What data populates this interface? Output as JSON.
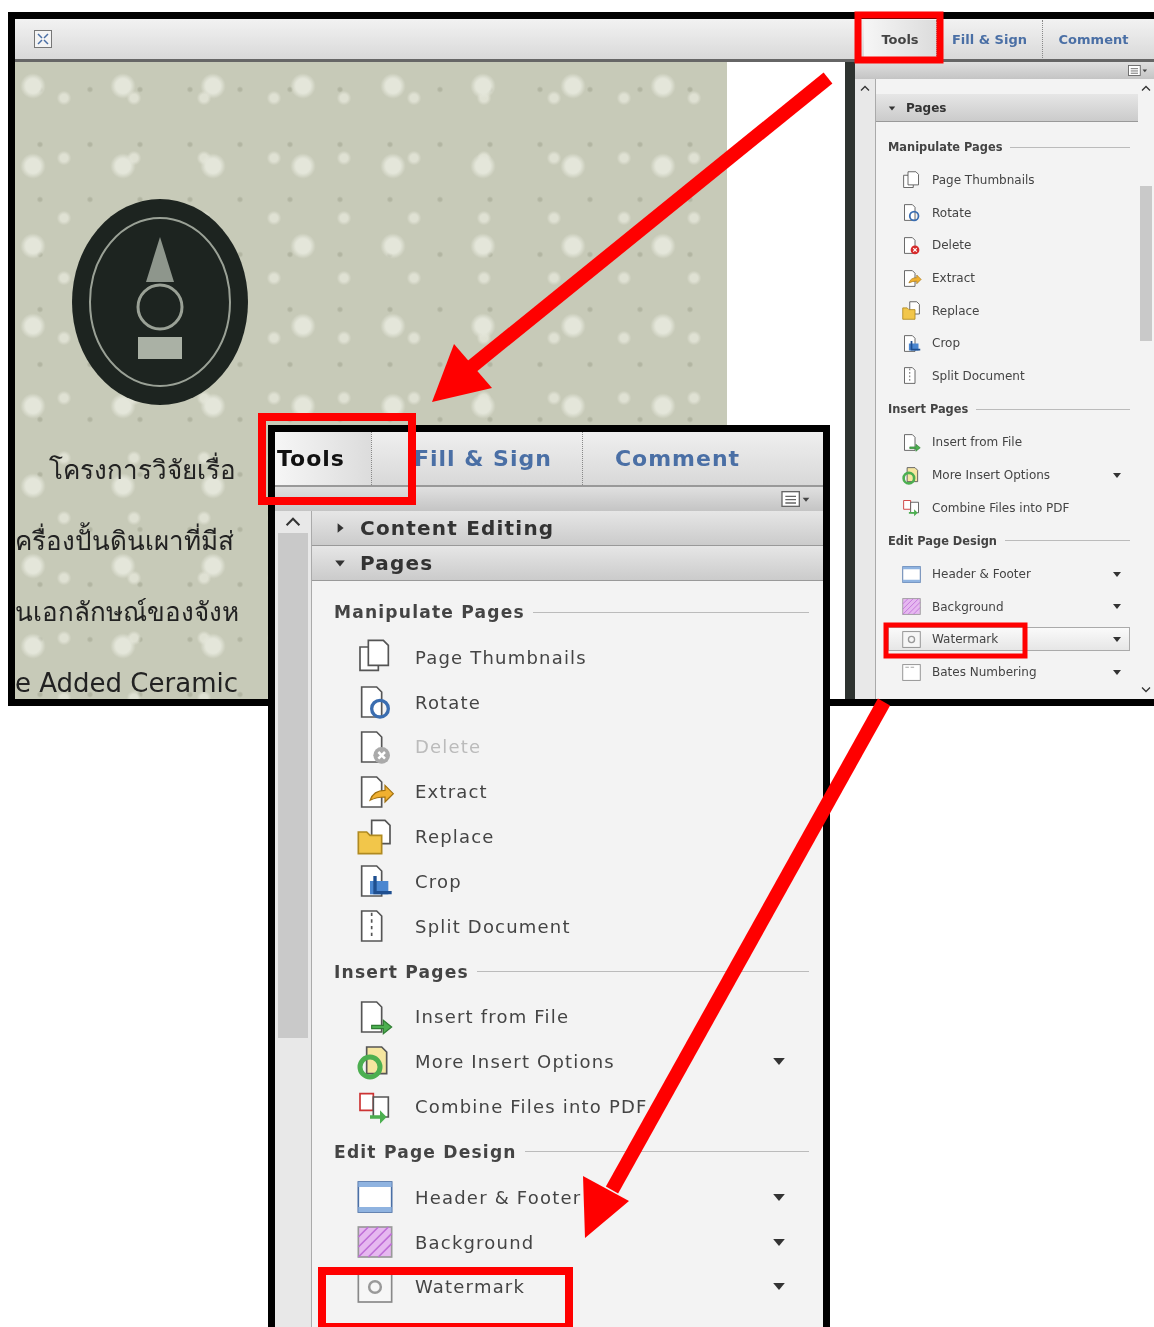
{
  "window": {
    "tabs": [
      {
        "label": "Tools",
        "selected": true
      },
      {
        "label": "Fill & Sign",
        "selected": false
      },
      {
        "label": "Comment",
        "selected": false
      }
    ],
    "document": {
      "lines": [
        "โครงการวิจัยเรื่อ",
        "ครื่องปั้นดินเผาที่มีส่",
        "นเอกลักษณ์ของจังห",
        "e Added Ceramic"
      ]
    },
    "tools_pane": {
      "panels": [
        {
          "label": "Pages",
          "expanded": true,
          "groups": [
            {
              "title": "Manipulate Pages",
              "items": [
                {
                  "label": "Page Thumbnails",
                  "kind": "plain",
                  "disabled": false,
                  "selected": false
                },
                {
                  "label": "Rotate",
                  "kind": "plain",
                  "disabled": false,
                  "selected": false
                },
                {
                  "label": "Delete",
                  "kind": "plain",
                  "disabled": false,
                  "selected": false
                },
                {
                  "label": "Extract",
                  "kind": "plain",
                  "disabled": false,
                  "selected": false
                },
                {
                  "label": "Replace",
                  "kind": "plain",
                  "disabled": false,
                  "selected": false
                },
                {
                  "label": "Crop",
                  "kind": "plain",
                  "disabled": false,
                  "selected": false
                },
                {
                  "label": "Split Document",
                  "kind": "plain",
                  "disabled": false,
                  "selected": false
                }
              ]
            },
            {
              "title": "Insert Pages",
              "items": [
                {
                  "label": "Insert from File",
                  "kind": "plain",
                  "disabled": false,
                  "selected": false
                },
                {
                  "label": "More Insert Options",
                  "kind": "menu",
                  "disabled": false,
                  "selected": false
                },
                {
                  "label": "Combine Files into PDF",
                  "kind": "plain",
                  "disabled": false,
                  "selected": false
                }
              ]
            },
            {
              "title": "Edit Page Design",
              "items": [
                {
                  "label": "Header & Footer",
                  "kind": "menu",
                  "disabled": false,
                  "selected": false
                },
                {
                  "label": "Background",
                  "kind": "menu",
                  "disabled": false,
                  "selected": false
                },
                {
                  "label": "Watermark",
                  "kind": "menu",
                  "disabled": false,
                  "selected": true
                },
                {
                  "label": "Bates Numbering",
                  "kind": "menu",
                  "disabled": false,
                  "selected": false
                }
              ]
            }
          ]
        }
      ]
    }
  },
  "zoom_inset": {
    "tabs": [
      {
        "label": "Tools",
        "selected": true
      },
      {
        "label": "Fill & Sign",
        "selected": false
      },
      {
        "label": "Comment",
        "selected": false
      }
    ],
    "tools_pane": {
      "panels": [
        {
          "label": "Content Editing",
          "expanded": false
        },
        {
          "label": "Pages",
          "expanded": true,
          "groups": [
            {
              "title": "Manipulate Pages",
              "items": [
                {
                  "label": "Page Thumbnails",
                  "kind": "plain",
                  "disabled": false,
                  "selected": false
                },
                {
                  "label": "Rotate",
                  "kind": "plain",
                  "disabled": false,
                  "selected": false
                },
                {
                  "label": "Delete",
                  "kind": "plain",
                  "disabled": true,
                  "selected": false
                },
                {
                  "label": "Extract",
                  "kind": "plain",
                  "disabled": false,
                  "selected": false
                },
                {
                  "label": "Replace",
                  "kind": "plain",
                  "disabled": false,
                  "selected": false
                },
                {
                  "label": "Crop",
                  "kind": "plain",
                  "disabled": false,
                  "selected": false
                },
                {
                  "label": "Split Document",
                  "kind": "plain",
                  "disabled": false,
                  "selected": false
                }
              ]
            },
            {
              "title": "Insert Pages",
              "items": [
                {
                  "label": "Insert from File",
                  "kind": "plain",
                  "disabled": false,
                  "selected": false
                },
                {
                  "label": "More Insert Options",
                  "kind": "menu",
                  "disabled": false,
                  "selected": false
                },
                {
                  "label": "Combine Files into PDF",
                  "kind": "plain",
                  "disabled": false,
                  "selected": false
                }
              ]
            },
            {
              "title": "Edit Page Design",
              "items": [
                {
                  "label": "Header & Footer",
                  "kind": "menu",
                  "disabled": false,
                  "selected": false
                },
                {
                  "label": "Background",
                  "kind": "menu",
                  "disabled": false,
                  "selected": false
                },
                {
                  "label": "Watermark",
                  "kind": "menu",
                  "disabled": false,
                  "selected": false
                }
              ]
            }
          ]
        }
      ]
    }
  }
}
